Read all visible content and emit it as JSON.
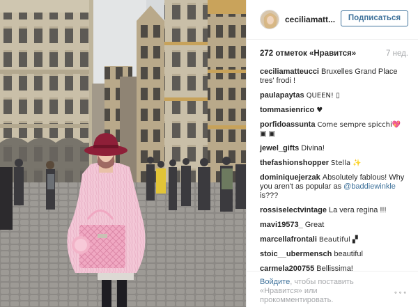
{
  "post": {
    "username": "ceciliamatt...",
    "follow_label": "Подписаться",
    "likes": "272 отметок «Нравится»",
    "age": "7 нед."
  },
  "comments": [
    {
      "user": "ceciliamatteucci",
      "text": "Bruxelles Grand Place tres' frodi !"
    },
    {
      "user": "paulapaytas",
      "text": "QUEEN! ▯"
    },
    {
      "user": "tommasienrico",
      "text": "♥"
    },
    {
      "user": "porfidoassunta",
      "text": "Come sempre spicchi💖▣ ▣"
    },
    {
      "user": "jewel_gifts",
      "text": "Divina!"
    },
    {
      "user": "thefashionshopper",
      "text": "Stella ✨"
    },
    {
      "user": "dominiquejerzak",
      "text": "Absolutely fablous! Why you aren't as popular as ",
      "mention": "@baddiewinkle",
      "text_after": " is???"
    },
    {
      "user": "rossiselectvintage",
      "text": "La vera regina !!!"
    },
    {
      "user": "mavi19573_",
      "text": "Great"
    },
    {
      "user": "marcellafrontali",
      "text": "Beautiful ▞"
    },
    {
      "user": "stoic__ubermensch",
      "text": "beautiful"
    },
    {
      "user": "carmela200755",
      "text": "Bellissima!"
    }
  ],
  "footer": {
    "login_link": "Войдите",
    "login_rest": ", чтобы поставить «Нравится» или прокомментировать.",
    "more_label": "∘∘∘"
  },
  "colors": {
    "link": "#3f729b",
    "muted": "#a5a7aa",
    "text": "#262626"
  }
}
